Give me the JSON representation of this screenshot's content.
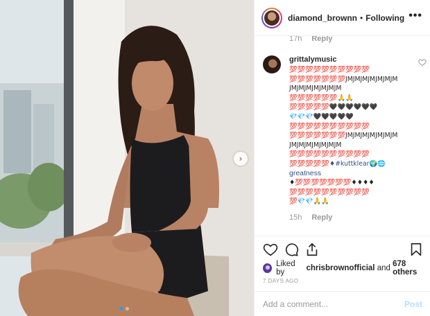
{
  "header": {
    "username": "diamond_brownn",
    "separator": "•",
    "follow_status": "Following",
    "more_label": "•••"
  },
  "previous_comment": {
    "time": "17h",
    "reply_label": "Reply"
  },
  "comment": {
    "username": "grittalymusic",
    "lines": [
      "💯💯💯💯💯💯💯💯💯💯",
      "💯💯💯💯💯💯💯JMJMJMJMJMJMJM",
      "JMJMJMJMJMJMJM",
      "💯💯💯💯💯💯🙏🙏",
      "💯💯💯💯💯🖤🖤🖤🖤🖤🖤",
      "💎💎💎🖤🖤🖤🖤🖤",
      "💯💯💯💯💯💯💯💯💯💯",
      "💯💯💯💯💯💯💯JMJMJMJMJMJMJM",
      "JMJMJMJMJMJMJM",
      "💯💯💯💯💯💯💯💯💯💯",
      "💯💯💯💯💯♦#kuttklear🌍🌐",
      "greatness",
      "♦💯💯💯💯💯💯💯♦♦♦♦",
      "💯💯💯💯💯💯💯💯💯💯",
      "💯💎💎🙏🙏"
    ],
    "hashtag": "#kuttklear",
    "hashtag_tail": "greatness",
    "time": "15h",
    "reply_label": "Reply"
  },
  "likes": {
    "prefix": "Liked by ",
    "user": "chrisbrownofficial",
    "middle": " and ",
    "others": "678 others"
  },
  "timestamp": "7 DAYS AGO",
  "add_comment": {
    "placeholder": "Add a comment...",
    "post_label": "Post"
  },
  "carousel": {
    "count": 2,
    "active": 0,
    "next_icon": "›"
  },
  "colors": {
    "accent_blue": "#2b9bf0",
    "post_disabled": "#b2dffc",
    "hashtag": "#385185",
    "muted": "#999999"
  },
  "icons": {
    "like": "heart-icon",
    "comment": "comment-icon",
    "share": "share-icon",
    "save": "bookmark-icon",
    "more": "more-options-icon"
  }
}
